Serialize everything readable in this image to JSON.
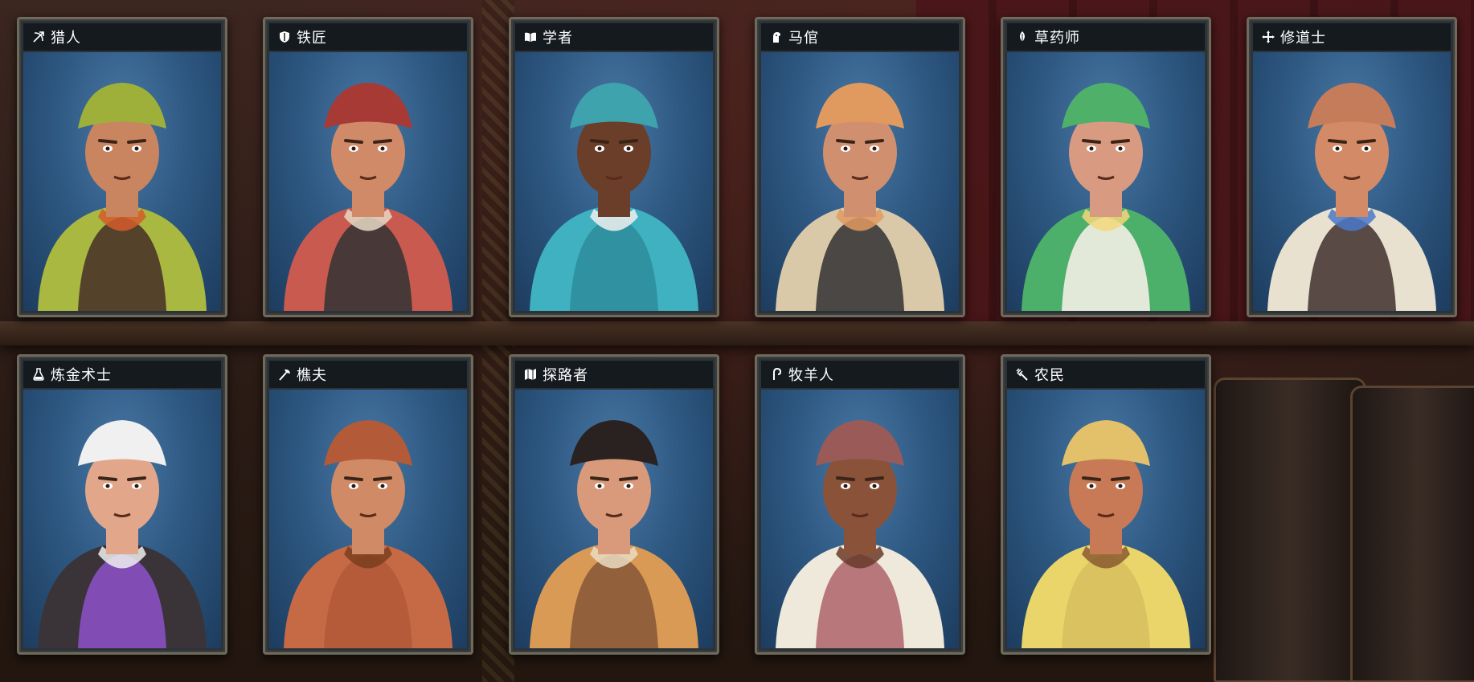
{
  "cards": [
    {
      "name": "猎人",
      "icon": "bow-arrow-icon",
      "skin": "#c98460",
      "hat": "#9fb03a",
      "shirt": "#a9b840",
      "vest": "#4a3528",
      "accent": "#d55a2a"
    },
    {
      "name": "铁匠",
      "icon": "shield-icon",
      "skin": "#d08a68",
      "hat": "#a83a35",
      "shirt": "#c95a50",
      "vest": "#3a3535",
      "accent": "#e6d9c4"
    },
    {
      "name": "学者",
      "icon": "book-icon",
      "skin": "#6a3e28",
      "hat": "#3fa3ad",
      "shirt": "#3fb1c0",
      "vest": "#2f8e9c",
      "accent": "#f0f0f0"
    },
    {
      "name": "马倌",
      "icon": "horse-icon",
      "skin": "#d09070",
      "hat": "#e09a60",
      "shirt": "#d9c9a8",
      "vest": "#3a3838",
      "accent": "#e09a60"
    },
    {
      "name": "草药师",
      "icon": "leaf-icon",
      "skin": "#d89a80",
      "hat": "#4fb06a",
      "shirt": "#4caf6a",
      "vest": "#f3f0e6",
      "accent": "#f3d77a"
    },
    {
      "name": "修道士",
      "icon": "cross-icon",
      "skin": "#d38a66",
      "hat": "#c47c5a",
      "shirt": "#e9e1cf",
      "vest": "#4a3a36",
      "accent": "#4a78c8"
    },
    {
      "name": "炼金术士",
      "icon": "flask-icon",
      "skin": "#e2a78a",
      "hat": "#f0f0f0",
      "shirt": "#3a3438",
      "vest": "#8a4fc2",
      "accent": "#f0f0f0"
    },
    {
      "name": "樵夫",
      "icon": "axe-icon",
      "skin": "#d08a66",
      "hat": "#b35a38",
      "shirt": "#c66a45",
      "vest": "#b35a38",
      "accent": "#7a4020"
    },
    {
      "name": "探路者",
      "icon": "map-icon",
      "skin": "#d89a7a",
      "hat": "#2a2220",
      "shirt": "#d99a55",
      "vest": "#8a5a38",
      "accent": "#e9dcc3"
    },
    {
      "name": "牧羊人",
      "icon": "crook-icon",
      "skin": "#8a5238",
      "hat": "#9a5a58",
      "shirt": "#efe9dc",
      "vest": "#b06a70",
      "accent": "#6a3a2a"
    },
    {
      "name": "农民",
      "icon": "pitchfork-icon",
      "skin": "#c77a55",
      "hat": "#e2c16a",
      "shirt": "#e9d56a",
      "vest": "#d8c060",
      "accent": "#8a5a30"
    }
  ]
}
